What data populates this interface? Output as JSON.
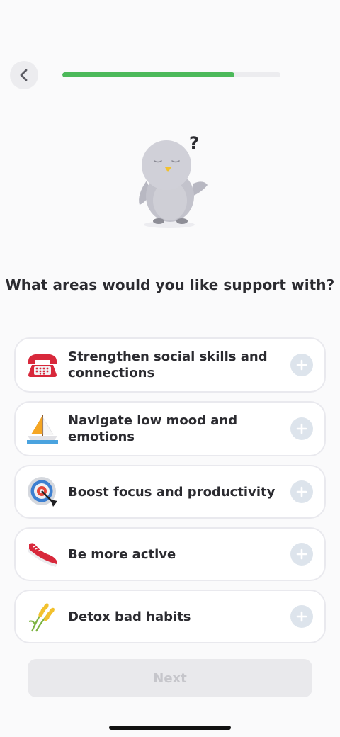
{
  "header": {
    "progress_fraction": 0.79
  },
  "question": "What areas would you like support with?",
  "options": [
    {
      "label": "Strengthen social skills and connections",
      "icon": "telephone-icon"
    },
    {
      "label": "Navigate low mood and emotions",
      "icon": "sailboat-icon"
    },
    {
      "label": "Boost focus and productivity",
      "icon": "target-icon"
    },
    {
      "label": "Be more active",
      "icon": "sneaker-icon"
    },
    {
      "label": "Detox bad habits",
      "icon": "wheat-icon"
    }
  ],
  "next_label": "Next",
  "mascot": {
    "symbol": "?"
  },
  "colors": {
    "progress": "#4cb95a",
    "plus_button": "#dde4ec",
    "next_disabled_bg": "#e9e9ec"
  }
}
